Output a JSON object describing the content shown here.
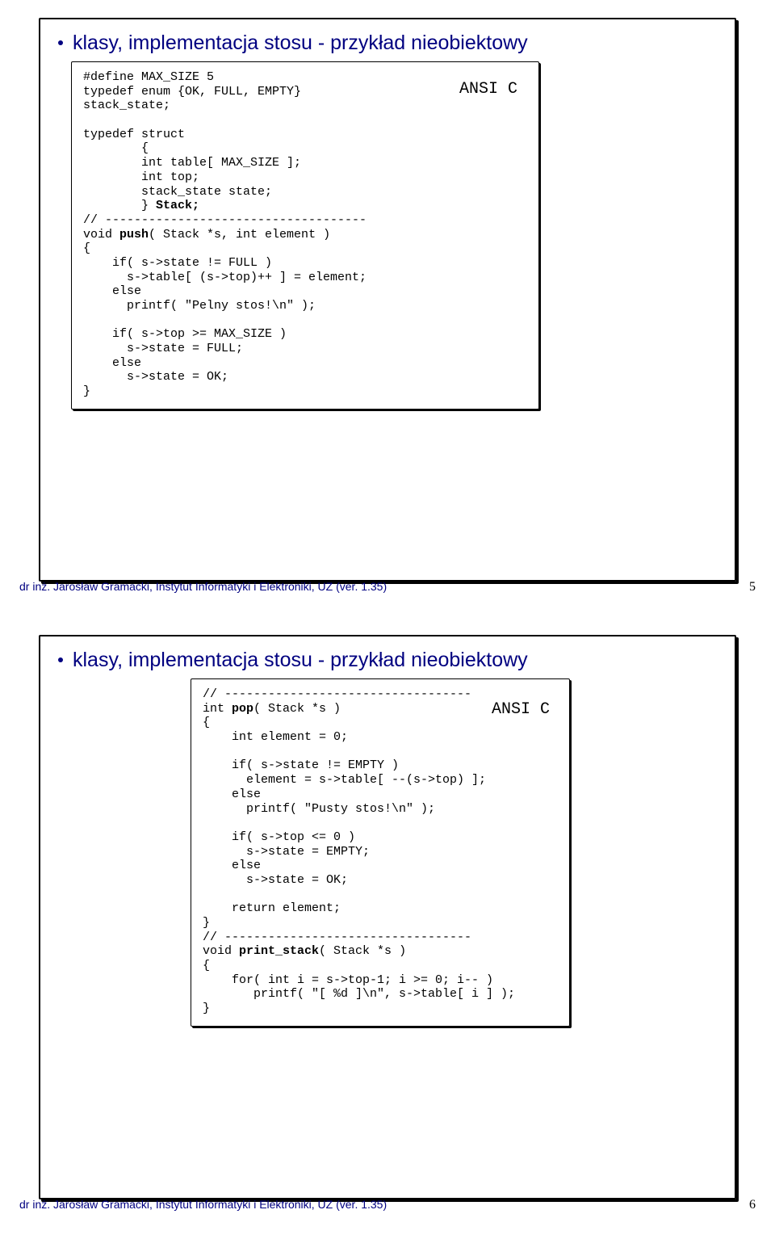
{
  "slide1": {
    "title": "klasy, implementacja stosu - przykład nieobiektowy",
    "lang": "ANSI C",
    "footer_left": "dr inż. Jarosław Gramacki, Instytut Informatyki i Elektroniki, UZ (ver. 1.35)",
    "footer_page": "5",
    "code": {
      "l01": "#define MAX_SIZE 5",
      "l02": "typedef enum {OK, FULL, EMPTY}",
      "l03": "stack_state;",
      "l04": "typedef struct",
      "l05": "        {",
      "l06": "        int table[ MAX_SIZE ];",
      "l07": "        int top;",
      "l08": "        stack_state state;",
      "l09a": "        } ",
      "l09b": "Stack;",
      "l10": "// ------------------------------------",
      "l11a": "void ",
      "l11b": "push",
      "l11c": "( Stack *s, int element )",
      "l12": "{",
      "l13": "    if( s->state != FULL )",
      "l14": "      s->table[ (s->top)++ ] = element;",
      "l15": "    else",
      "l16": "      printf( \"Pelny stos!\\n\" );",
      "l17": "    if( s->top >= MAX_SIZE )",
      "l18": "      s->state = FULL;",
      "l19": "    else",
      "l20": "      s->state = OK;",
      "l21": "}"
    }
  },
  "slide2": {
    "title": "klasy, implementacja stosu - przykład nieobiektowy",
    "lang": "ANSI C",
    "footer_left": "dr inż. Jarosław Gramacki, Instytut Informatyki i Elektroniki, UZ (ver. 1.35)",
    "footer_page": "6",
    "code": {
      "l01": "// ----------------------------------",
      "l02a": "int ",
      "l02b": "pop",
      "l02c": "( Stack *s )",
      "l03": "{",
      "l04": "    int element = 0;",
      "l05": "    if( s->state != EMPTY )",
      "l06": "      element = s->table[ --(s->top) ];",
      "l07": "    else",
      "l08": "      printf( \"Pusty stos!\\n\" );",
      "l09": "    if( s->top <= 0 )",
      "l10": "      s->state = EMPTY;",
      "l11": "    else",
      "l12": "      s->state = OK;",
      "l13": "    return element;",
      "l14": "}",
      "l15": "// ----------------------------------",
      "l16a": "void ",
      "l16b": "print_stack",
      "l16c": "( Stack *s )",
      "l17": "{",
      "l18": "    for( int i = s->top-1; i >= 0; i-- )",
      "l19": "       printf( \"[ %d ]\\n\", s->table[ i ] );",
      "l20": "}"
    }
  }
}
